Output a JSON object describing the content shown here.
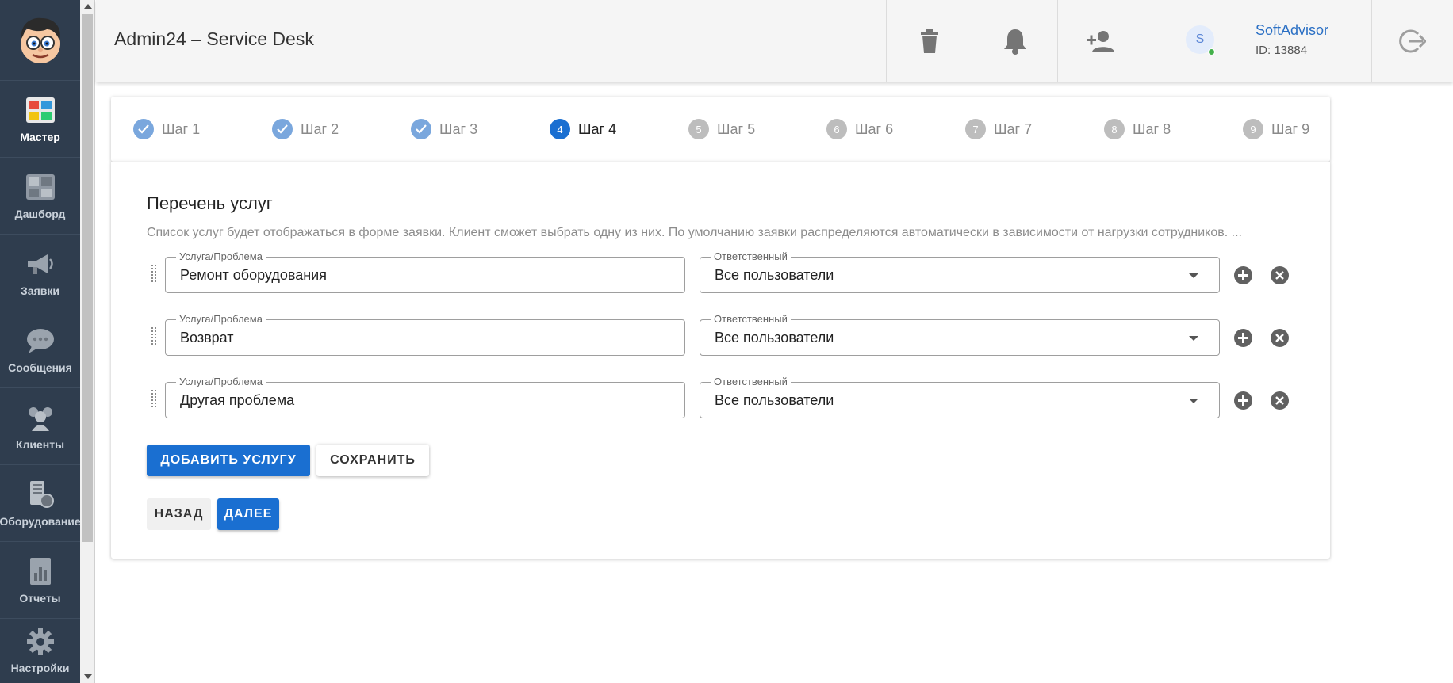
{
  "app": {
    "title": "Admin24 – Service Desk"
  },
  "sidebar": {
    "items": [
      {
        "label": "Мастер",
        "icon": "wizard-icon"
      },
      {
        "label": "Дашборд",
        "icon": "dashboard-icon"
      },
      {
        "label": "Заявки",
        "icon": "megaphone-icon"
      },
      {
        "label": "Сообщения",
        "icon": "chat-bubble-icon"
      },
      {
        "label": "Клиенты",
        "icon": "clients-icon"
      },
      {
        "label": "Оборудование",
        "icon": "equipment-icon"
      },
      {
        "label": "Отчеты",
        "icon": "reports-icon"
      },
      {
        "label": "Настройки",
        "icon": "gear-icon"
      }
    ]
  },
  "header": {
    "actions": [
      "trash-icon",
      "bell-icon",
      "add-user-icon",
      "logout-icon"
    ],
    "user": {
      "initial": "S",
      "name": "SoftAdvisor",
      "id_text": "ID: 13884"
    }
  },
  "stepper": {
    "steps": [
      {
        "num": "1",
        "label": "Шаг 1",
        "state": "done"
      },
      {
        "num": "2",
        "label": "Шаг 2",
        "state": "done"
      },
      {
        "num": "3",
        "label": "Шаг 3",
        "state": "done"
      },
      {
        "num": "4",
        "label": "Шаг 4",
        "state": "current"
      },
      {
        "num": "5",
        "label": "Шаг 5",
        "state": "todo"
      },
      {
        "num": "6",
        "label": "Шаг 6",
        "state": "todo"
      },
      {
        "num": "7",
        "label": "Шаг 7",
        "state": "todo"
      },
      {
        "num": "8",
        "label": "Шаг 8",
        "state": "todo"
      },
      {
        "num": "9",
        "label": "Шаг 9",
        "state": "todo"
      }
    ]
  },
  "card": {
    "title": "Перечень услуг",
    "description": "Список услуг будет отображаться в форме заявки. Клиент сможет выбрать одну из них. По умолчанию заявки распределяются автоматически в зависимости от нагрузки сотрудников. ...",
    "service_label": "Услуга/Проблема",
    "responsible_label": "Ответственный",
    "rows": [
      {
        "service": "Ремонт оборудования",
        "responsible": "Все пользователи"
      },
      {
        "service": "Возврат",
        "responsible": "Все пользователи"
      },
      {
        "service": "Другая проблема",
        "responsible": "Все пользователи"
      }
    ],
    "add_service_label": "ДОБАВИТЬ УСЛУГУ",
    "save_label": "СОХРАНИТЬ",
    "back_label": "НАЗАД",
    "next_label": "ДАЛЕЕ"
  }
}
